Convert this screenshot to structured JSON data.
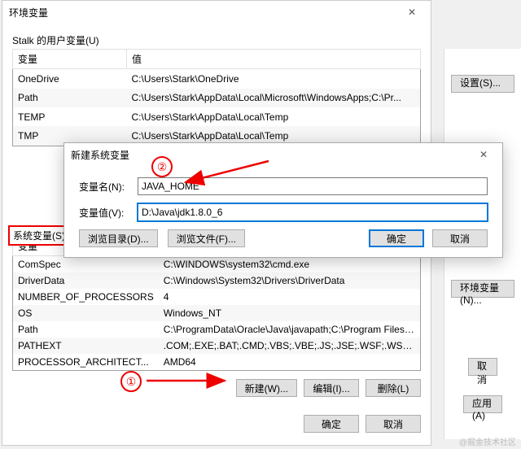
{
  "envWindow": {
    "title": "环境变量",
    "userVarsLabel": "Stalk 的用户变量(U)",
    "colVar": "变量",
    "colVal": "值",
    "userVars": [
      {
        "name": "OneDrive",
        "value": "C:\\Users\\Stark\\OneDrive"
      },
      {
        "name": "Path",
        "value": "C:\\Users\\Stark\\AppData\\Local\\Microsoft\\WindowsApps;C:\\Pr..."
      },
      {
        "name": "TEMP",
        "value": "C:\\Users\\Stark\\AppData\\Local\\Temp"
      },
      {
        "name": "TMP",
        "value": "C:\\Users\\Stark\\AppData\\Local\\Temp"
      }
    ],
    "sysVarsLabel": "系统变量(S)",
    "sysVars": [
      {
        "name": "ComSpec",
        "value": "C:\\WINDOWS\\system32\\cmd.exe"
      },
      {
        "name": "DriverData",
        "value": "C:\\Windows\\System32\\Drivers\\DriverData"
      },
      {
        "name": "NUMBER_OF_PROCESSORS",
        "value": "4"
      },
      {
        "name": "OS",
        "value": "Windows_NT"
      },
      {
        "name": "Path",
        "value": "C:\\ProgramData\\Oracle\\Java\\javapath;C:\\Program Files\\VanD..."
      },
      {
        "name": "PATHEXT",
        "value": ".COM;.EXE;.BAT;.CMD;.VBS;.VBE;.JS;.JSE;.WSF;.WSH;.MSC"
      },
      {
        "name": "PROCESSOR_ARCHITECT...",
        "value": "AMD64"
      }
    ],
    "buttons": {
      "new": "新建(W)...",
      "edit": "编辑(I)...",
      "delete": "删除(L)",
      "ok": "确定",
      "cancel": "取消"
    }
  },
  "newVarDialog": {
    "title": "新建系统变量",
    "nameLabel": "变量名(N):",
    "nameValue": "JAVA_HOME",
    "valueLabel": "变量值(V):",
    "valueValue": "D:\\Java\\jdk1.8.0_6",
    "browseDir": "浏览目录(D)...",
    "browseFile": "浏览文件(F)...",
    "ok": "确定",
    "cancel": "取消"
  },
  "rightPanel": {
    "settings": "设置(S)...",
    "envVars": "环境变量(N)...",
    "cancel": "取消",
    "apply": "应用(A)"
  },
  "callouts": {
    "one": "①",
    "two": "②"
  },
  "watermark": "@掘金技术社区"
}
